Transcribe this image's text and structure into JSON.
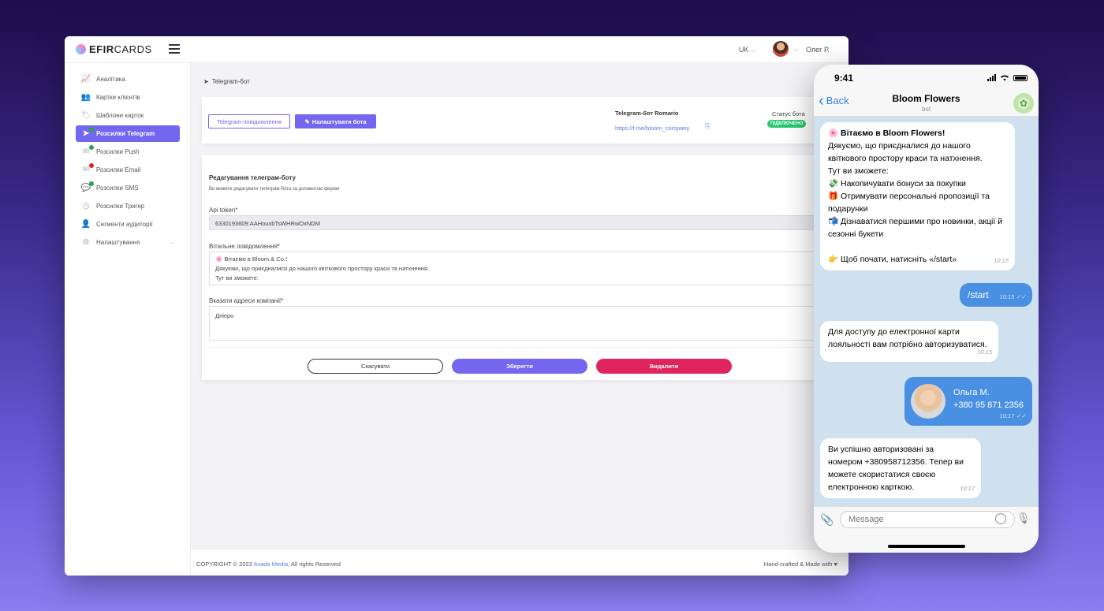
{
  "admin": {
    "logo_bold": "EFIR",
    "logo_rest": "CARDS",
    "lang": "UK",
    "user_name": "Олег Р.",
    "sidebar": {
      "items": [
        {
          "label": "Аналітика"
        },
        {
          "label": "Картки клієнтів"
        },
        {
          "label": "Шаблони карток"
        },
        {
          "label": "Розсилки Telegram"
        },
        {
          "label": "Розсилки Push"
        },
        {
          "label": "Розсилки Email"
        },
        {
          "label": "Розсилки SMS"
        },
        {
          "label": "Розсилки Тригер"
        },
        {
          "label": "Сегменти аудиторії"
        },
        {
          "label": "Налаштування"
        }
      ]
    },
    "breadcrumb": "Telegram-бот",
    "bot_card": {
      "messages_button": "Telegram-повідомлення",
      "settings_button": "Налаштувати бота",
      "bot_name": "Telegram-бот Romario",
      "bot_link": "https://t.me/bloom_company",
      "status_label": "Статус бота",
      "status_value": "ПІДКЛЮЧЕНО",
      "status_color": "#28c76f"
    },
    "form": {
      "title": "Редагування телеграм-боту",
      "subtitle": "Ви можете редагувати телеграм-бота за допомогою форми",
      "token_label": "Api token*",
      "token_value": "6330193609:AAHouxbTsWHRwOxNDM",
      "welcome_label": "Вітальне повідомлення*",
      "welcome_line1": "🌸 Вітаємо в Bloom & Co.!",
      "welcome_line2": "Дякуємо, що приєдналися до нашого квіткового простору краси та натхнення.",
      "welcome_line3": "Тут ви зможете:",
      "address_label": "Вказати адреси компанії*",
      "address_value": "Дніпро",
      "cancel": "Скасувати",
      "save": "Зберегти",
      "delete": "Видалити"
    },
    "footer": {
      "copyright_prefix": "COPYRIGHT © 2023",
      "company": "Avada Media",
      "copyright_suffix": ", All rights Reserved",
      "right": "Hand-crafted & Made with ♥"
    },
    "accent_color": "#7367f0",
    "danger_color": "#e0245e"
  },
  "phone": {
    "time": "9:41",
    "back": "Back",
    "chat_title": "Bloom Flowers",
    "chat_subtitle": "bot",
    "messages": {
      "welcome": {
        "lines": [
          "🌸 Вітаємо в Bloom Flowers!",
          "Дякуємо, що приєдналися до нашого",
          "квіткового простору краси та натхнення.",
          "Тут ви зможете:",
          "💸 Накопичувати бонуси за покупки",
          "🎁 Отримувати персональні пропозиції та",
          "подарунки",
          "📬 Дізнаватися першими про новинки, акції й",
          "сезонні букети",
          "",
          "👉 Щоб почати, натисніть «/start»"
        ],
        "time": "10:15"
      },
      "start": {
        "text": "/start",
        "time": "10:15"
      },
      "auth_prompt": {
        "line1": "Для доступу до електронної карти",
        "line2": "лояльності вам потрібно авторизуватися.",
        "time": "10:15"
      },
      "contact": {
        "name": "Ольга М.",
        "phone": "+380 95 871 2356",
        "time": "10:17"
      },
      "auth_ok": {
        "line1": "Ви успішно авторизовані за",
        "line2": "номером +380958712356. Тепер ви",
        "line3": "можете скористатися своєю",
        "line4": "електронною карткою.",
        "time": "10:17"
      }
    },
    "input_placeholder": "Message",
    "outgoing_color": "#4a90e2"
  }
}
